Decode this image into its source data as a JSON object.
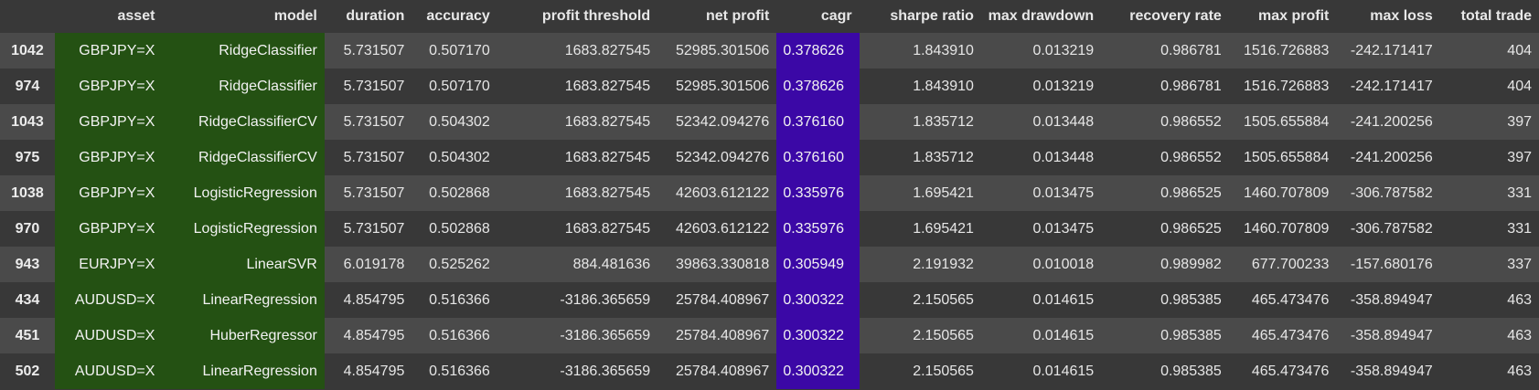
{
  "table": {
    "headers": [
      "",
      "asset",
      "model",
      "duration",
      "accuracy",
      "profit threshold",
      "net profit",
      "cagr",
      "sharpe ratio",
      "max drawdown",
      "recovery rate",
      "max profit",
      "max loss",
      "total trade"
    ],
    "rows": [
      [
        "1042",
        "GBPJPY=X",
        "RidgeClassifier",
        "5.731507",
        "0.507170",
        "1683.827545",
        "52985.301506",
        "0.378626",
        "1.843910",
        "0.013219",
        "0.986781",
        "1516.726883",
        "-242.171417",
        "404"
      ],
      [
        "974",
        "GBPJPY=X",
        "RidgeClassifier",
        "5.731507",
        "0.507170",
        "1683.827545",
        "52985.301506",
        "0.378626",
        "1.843910",
        "0.013219",
        "0.986781",
        "1516.726883",
        "-242.171417",
        "404"
      ],
      [
        "1043",
        "GBPJPY=X",
        "RidgeClassifierCV",
        "5.731507",
        "0.504302",
        "1683.827545",
        "52342.094276",
        "0.376160",
        "1.835712",
        "0.013448",
        "0.986552",
        "1505.655884",
        "-241.200256",
        "397"
      ],
      [
        "975",
        "GBPJPY=X",
        "RidgeClassifierCV",
        "5.731507",
        "0.504302",
        "1683.827545",
        "52342.094276",
        "0.376160",
        "1.835712",
        "0.013448",
        "0.986552",
        "1505.655884",
        "-241.200256",
        "397"
      ],
      [
        "1038",
        "GBPJPY=X",
        "LogisticRegression",
        "5.731507",
        "0.502868",
        "1683.827545",
        "42603.612122",
        "0.335976",
        "1.695421",
        "0.013475",
        "0.986525",
        "1460.707809",
        "-306.787582",
        "331"
      ],
      [
        "970",
        "GBPJPY=X",
        "LogisticRegression",
        "5.731507",
        "0.502868",
        "1683.827545",
        "42603.612122",
        "0.335976",
        "1.695421",
        "0.013475",
        "0.986525",
        "1460.707809",
        "-306.787582",
        "331"
      ],
      [
        "943",
        "EURJPY=X",
        "LinearSVR",
        "6.019178",
        "0.525262",
        "884.481636",
        "39863.330818",
        "0.305949",
        "2.191932",
        "0.010018",
        "0.989982",
        "677.700233",
        "-157.680176",
        "337"
      ],
      [
        "434",
        "AUDUSD=X",
        "LinearRegression",
        "4.854795",
        "0.516366",
        "-3186.365659",
        "25784.408967",
        "0.300322",
        "2.150565",
        "0.014615",
        "0.985385",
        "465.473476",
        "-358.894947",
        "463"
      ],
      [
        "451",
        "AUDUSD=X",
        "HuberRegressor",
        "4.854795",
        "0.516366",
        "-3186.365659",
        "25784.408967",
        "0.300322",
        "2.150565",
        "0.014615",
        "0.985385",
        "465.473476",
        "-358.894947",
        "463"
      ],
      [
        "502",
        "AUDUSD=X",
        "LinearRegression",
        "4.854795",
        "0.516366",
        "-3186.365659",
        "25784.408967",
        "0.300322",
        "2.150565",
        "0.014615",
        "0.985385",
        "465.473476",
        "-358.894947",
        "463"
      ]
    ]
  },
  "colors": {
    "highlight_green": "#245113",
    "highlight_purple": "#3b08a6",
    "row_odd": "#4a4a4a",
    "row_even": "#383838"
  }
}
